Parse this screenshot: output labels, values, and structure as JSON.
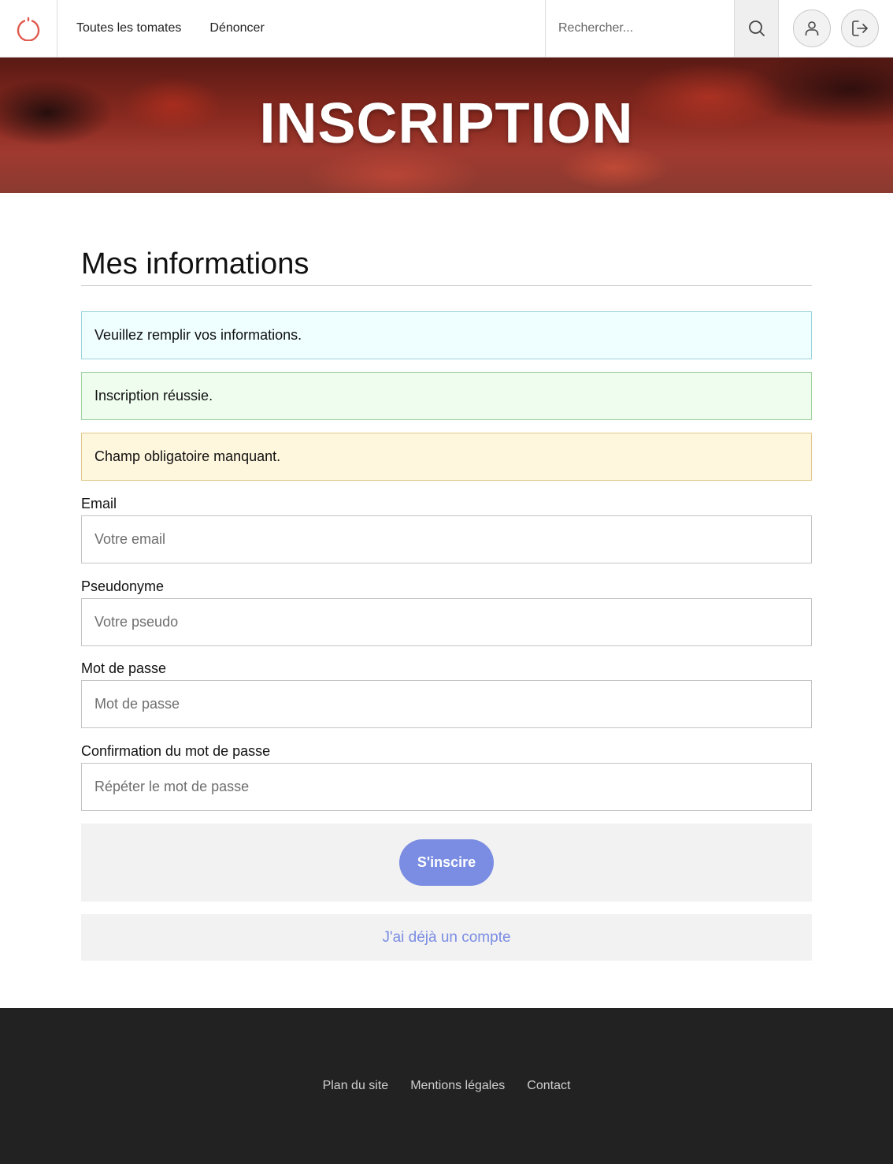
{
  "header": {
    "nav": [
      {
        "label": "Toutes les tomates"
      },
      {
        "label": "Dénoncer"
      }
    ],
    "search": {
      "placeholder": "Rechercher..."
    },
    "icons": {
      "logo": "power-icon",
      "search": "search-icon",
      "profile": "user-icon",
      "logout": "logout-icon"
    }
  },
  "hero": {
    "title": "INSCRIPTION"
  },
  "form": {
    "section_title": "Mes informations",
    "alerts": {
      "info": "Veuillez remplir vos informations.",
      "success": "Inscription réussie.",
      "warning": "Champ obligatoire manquant."
    },
    "fields": {
      "email": {
        "label": "Email",
        "placeholder": "Votre email"
      },
      "pseudo": {
        "label": "Pseudonyme",
        "placeholder": "Votre pseudo"
      },
      "password": {
        "label": "Mot de passe",
        "placeholder": "Mot de passe"
      },
      "confirm": {
        "label": "Confirmation du mot de passe",
        "placeholder": "Répéter le mot de passe"
      }
    },
    "submit_label": "S'inscire",
    "login_link": "J'ai déjà un compte"
  },
  "footer": {
    "links": [
      {
        "label": "Plan du site"
      },
      {
        "label": "Mentions légales"
      },
      {
        "label": "Contact"
      }
    ]
  },
  "colors": {
    "accent": "#7b8de3",
    "logo": "#e05a4e",
    "footer_bg": "#222222",
    "alert_info_bg": "#effeff",
    "alert_success_bg": "#effdef",
    "alert_warning_bg": "#fff7dd"
  }
}
